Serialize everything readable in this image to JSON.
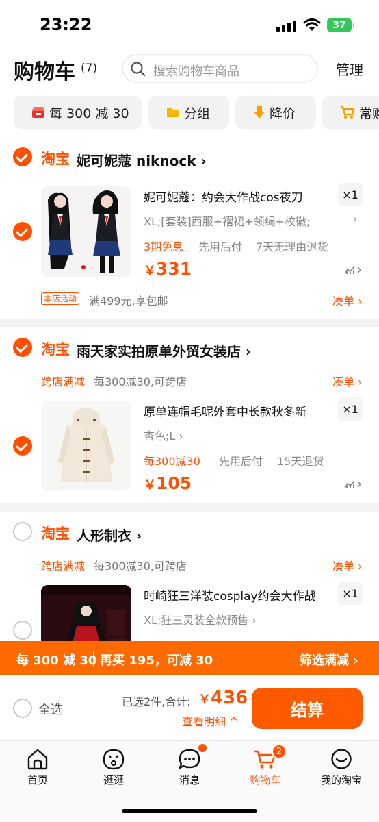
{
  "status_bar": {
    "time": "23:22",
    "battery": "37"
  },
  "header": {
    "title": "购物车",
    "count": "(7)",
    "search_placeholder": "搜索购物车商品",
    "manage_label": "管理"
  },
  "filter_chips": [
    {
      "label": "每 300 减 30",
      "icon": "store-coupon-icon"
    },
    {
      "label": "分组",
      "icon": "folder-icon"
    },
    {
      "label": "降价",
      "icon": "price-drop-arrow-icon"
    },
    {
      "label": "常购",
      "icon": "cart-icon"
    }
  ],
  "shops": [
    {
      "platform": "淘宝",
      "name": "妮可妮蔻 niknock",
      "checked": true,
      "item": {
        "title": "妮可妮蔻：约会大作战cos夜刀",
        "spec": "XL;[套装]西服+褶裙+领绳+校徽;",
        "tags": [
          "3期免息",
          "先用后付",
          "7天无理由退货"
        ],
        "price_symbol": "￥",
        "price": "331",
        "quantity": "×1",
        "checked": true
      },
      "activity_badge": "本店活动",
      "activity_text": "满499元,享包邮",
      "action_label": "凑单"
    },
    {
      "platform": "淘宝",
      "name": "雨天家实拍原单外贸女装店",
      "checked": true,
      "promo_label": "跨店满减",
      "promo_text": "每300减30,可跨店",
      "action_label": "凑单",
      "item": {
        "title": "原单连帽毛呢外套中长款秋冬新",
        "spec": "杏色;L",
        "tags": [
          "每300减30",
          "先用后付",
          "15天退货"
        ],
        "price_symbol": "￥",
        "price": "105",
        "quantity": "×1",
        "checked": true
      }
    },
    {
      "platform": "淘宝",
      "name": "人形制衣",
      "checked": false,
      "promo_label": "跨店满减",
      "promo_text": "每300减30,可跨店",
      "action_label": "凑单",
      "item": {
        "title": "时崎狂三洋装cosplay约会大作战",
        "spec": "XL;狂三灵装全款预售",
        "quantity": "×1",
        "checked": false
      }
    }
  ],
  "promo_strip": {
    "left": "每 300 减 30",
    "middle": "再买 195，可减 30",
    "right": "筛选满减"
  },
  "checkout": {
    "select_all": "全选",
    "selected_count": "已选2件,合计:",
    "total_symbol": "￥",
    "total": "436",
    "detail_link": "查看明细",
    "button": "结算"
  },
  "tabs": [
    {
      "label": "首页",
      "icon": "home-icon"
    },
    {
      "label": "逛逛",
      "icon": "explore-face-icon"
    },
    {
      "label": "消息",
      "icon": "message-bubble-icon"
    },
    {
      "label": "购物车",
      "icon": "cart-icon",
      "badge": "2",
      "active": true
    },
    {
      "label": "我的淘宝",
      "icon": "smile-icon"
    }
  ],
  "colors": {
    "accent": "#ff5000",
    "strip": "#ff6a00",
    "battery": "#34c759"
  }
}
